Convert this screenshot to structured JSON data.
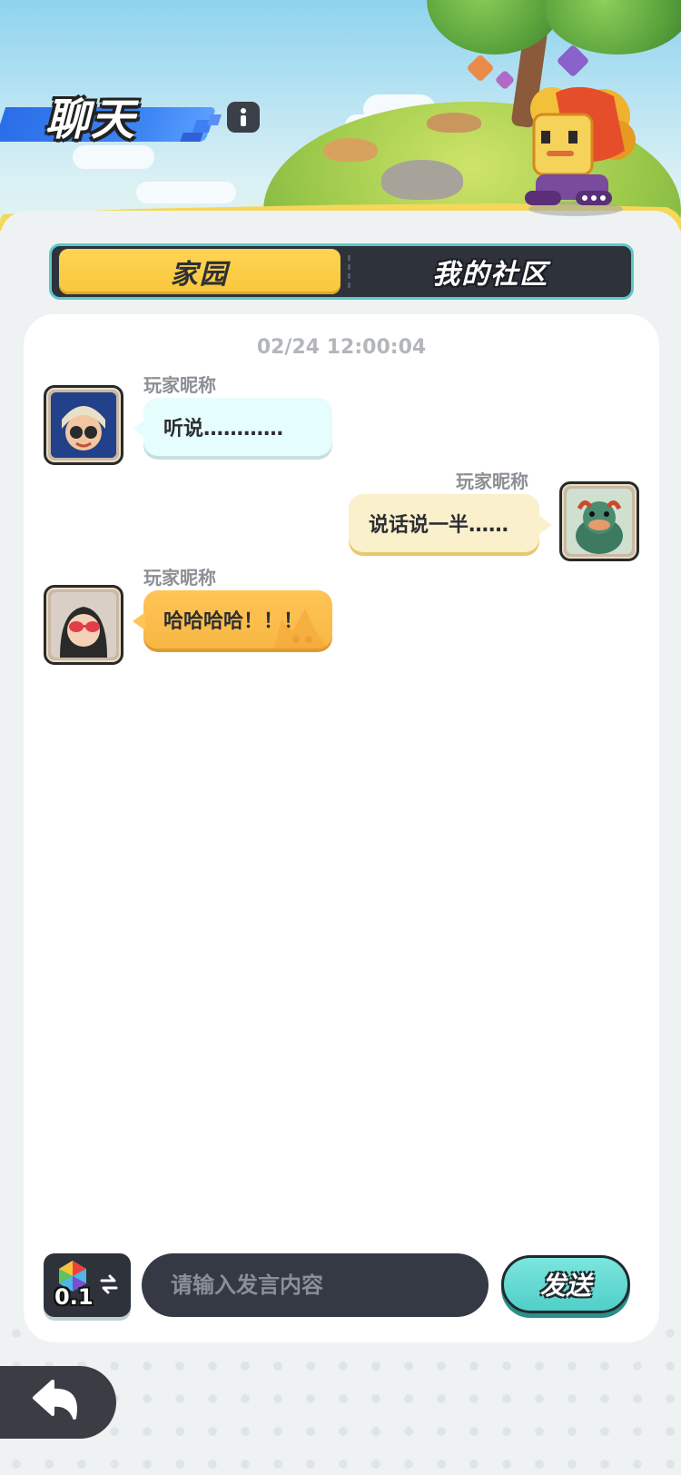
{
  "header": {
    "title": "聊天"
  },
  "tabs": [
    {
      "label": "家园",
      "active": true
    },
    {
      "label": "我的社区",
      "active": false
    }
  ],
  "chat": {
    "timestamp": "02/24 12:00:04",
    "messages": [
      {
        "nickname": "玩家昵称",
        "text": "听说…………",
        "side": "left",
        "bubble_color": "#e6fdfd"
      },
      {
        "nickname": "玩家昵称",
        "text": "说话说一半……",
        "side": "right",
        "bubble_color": "#fbf0cc"
      },
      {
        "nickname": "玩家昵称",
        "text": "哈哈哈哈！！！",
        "side": "left",
        "bubble_color": "#f8b743"
      }
    ]
  },
  "input_bar": {
    "emoji_count": "0.1",
    "placeholder": "请输入发言内容",
    "send_label": "发送"
  },
  "colors": {
    "accent_yellow": "#f8c73b",
    "accent_teal": "#4fcfc8",
    "dark": "#2d323b"
  }
}
